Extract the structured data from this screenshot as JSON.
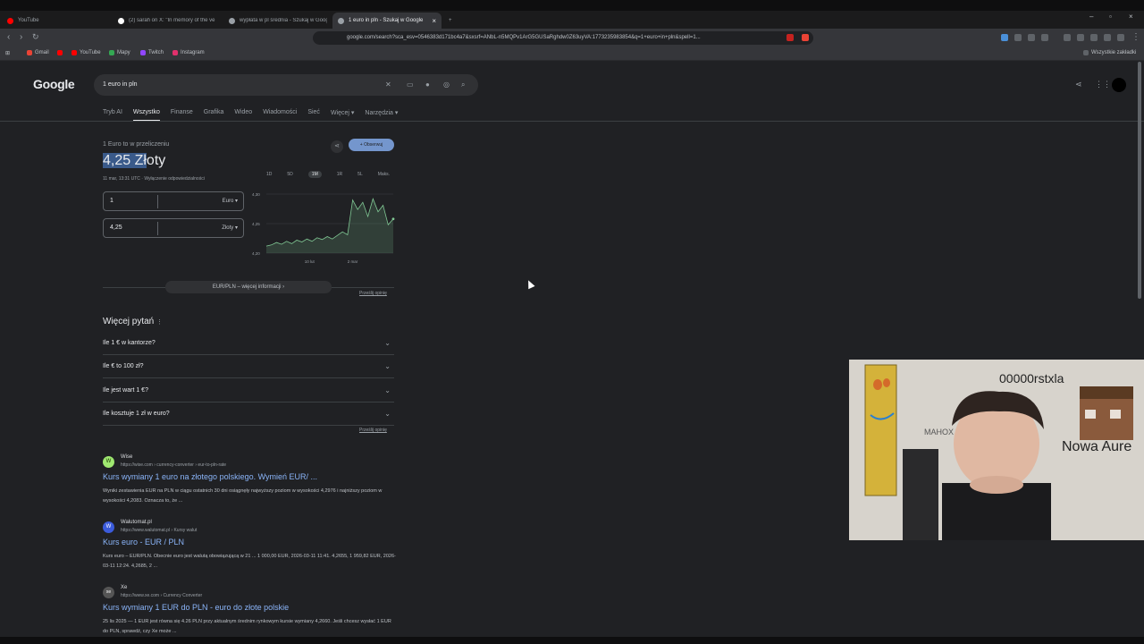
{
  "browser": {
    "tabs": [
      {
        "label": "YouTube",
        "color": "#ff0000"
      },
      {
        "label": "(2) sarah on X: \"In memory of the ve",
        "color": "#ffffff"
      },
      {
        "label": "wypłata w pl średnia - Szukaj w Goog",
        "color": "#9aa0a6"
      },
      {
        "label": "1 euro in pln - Szukaj w Google",
        "color": "#9aa0a6"
      }
    ],
    "new_tab": "+",
    "url": "google.com/search?sca_esv=0546383d171bc4a7&sxsrf=ANbL-n5MQPv1ArG5GUSaRghdw0Z63uyVA:1773235983854&q=1+euro+in+pln&spell=1...",
    "bookmarks": [
      {
        "label": "Gmail",
        "color": "#ea4335"
      },
      {
        "label": "",
        "color": "#ff0000"
      },
      {
        "label": "YouTube",
        "color": "#ff0000"
      },
      {
        "label": "Mapy",
        "color": "#34a853"
      },
      {
        "label": "Twitch",
        "color": "#9146ff"
      },
      {
        "label": "Instagram",
        "color": "#e1306c"
      }
    ],
    "all_bookmarks": "Wszystkie zakładki"
  },
  "google": {
    "logo": "Google",
    "query": "1 euro in pln",
    "nav": [
      "Tryb AI",
      "Wszystko",
      "Finanse",
      "Grafika",
      "Wideo",
      "Wiadomości",
      "Sieć",
      "Więcej ▾",
      "Narzędzia ▾"
    ]
  },
  "converter": {
    "label": "1 Euro to w przeliczeniu",
    "value_hl": "4,25 Zł",
    "value_rest": "oty",
    "timestamp": "11 mar, 13:31 UTC · Wyłączenie odpowiedzialności",
    "follow": "+ Obserwuj",
    "from_amount": "1",
    "from_currency": "Euro",
    "to_amount": "4,25",
    "to_currency": "Złoty",
    "ranges": [
      "1D",
      "5D",
      "1M",
      "1R",
      "5L",
      "Maks."
    ],
    "more_info": "EUR/PLN – więcej informacji  ›",
    "feedback": "Prześlij opinię"
  },
  "chart_data": {
    "type": "area",
    "title": "",
    "xlabel": "",
    "ylabel": "",
    "ylim": [
      4.2,
      4.3
    ],
    "yticks": [
      "4,30",
      "4,25",
      "4,20"
    ],
    "xticks": [
      "10 lut",
      "2 mar"
    ],
    "series": [
      {
        "name": "",
        "values": [
          4.212,
          4.214,
          4.218,
          4.215,
          4.22,
          4.216,
          4.222,
          4.219,
          4.224,
          4.22,
          4.226,
          4.223,
          4.228,
          4.224,
          4.23,
          4.236,
          4.231,
          4.29,
          4.274,
          4.286,
          4.262,
          4.292,
          4.27,
          4.281,
          4.248,
          4.258
        ]
      }
    ]
  },
  "paa": {
    "title": "Więcej pytań",
    "items": [
      "Ile 1 € w kantorze?",
      "Ile € to 100 zł?",
      "Ile jest wart 1 €?",
      "Ile kosztuje 1 zł w euro?"
    ],
    "feedback": "Prześlij opinię"
  },
  "results": [
    {
      "site": "Wise",
      "url": "https://wise.com › currency-converter › eur-to-pln-rate",
      "title": "Kurs wymiany 1 euro na złotego polskiego. Wymień EUR/ ...",
      "snippet": "Wyniki zestawienia EUR na PLN w ciągu ostatnich 30 dni osiągnęły najwyższy poziom w wysokości 4,2976 i najniższy poziom w wysokości 4,2083. Oznacza to, że ...",
      "fav": "W",
      "color": "#9fe870"
    },
    {
      "site": "Walutomat.pl",
      "url": "https://www.walutomat.pl › Kursy walut",
      "title": "Kurs euro - EUR / PLN",
      "snippet": "Kurs euro – EUR/PLN. Obecnie euro jest walutą obowiązującą w 21 ... 1 000,00 EUR, 2026-03-11 11:41. 4,2655, 1 959,82 EUR, 2026-03-11 12:24. 4,2685, 2 ...",
      "fav": "W",
      "color": "#3b5bdb"
    },
    {
      "site": "Xe",
      "url": "https://www.xe.com › Currency Converter",
      "title": "Kurs wymiany 1 EUR do PLN - euro do złote polskie",
      "snippet": "25 lis 2025 — 1 EUR jest równa się 4.26 PLN przy aktualnym średnim rynkowym kursie wymiany 4,2660. Jeśli chcesz wysłać 1 EUR do PLN, sprawdź, czy Xe może ...",
      "fav": "xe",
      "color": "#555"
    }
  ],
  "webcam": {
    "wall_text_1": "00000rstxla",
    "wall_text_2": "Nowa Aure",
    "wall_text_3": "MAHOX"
  }
}
